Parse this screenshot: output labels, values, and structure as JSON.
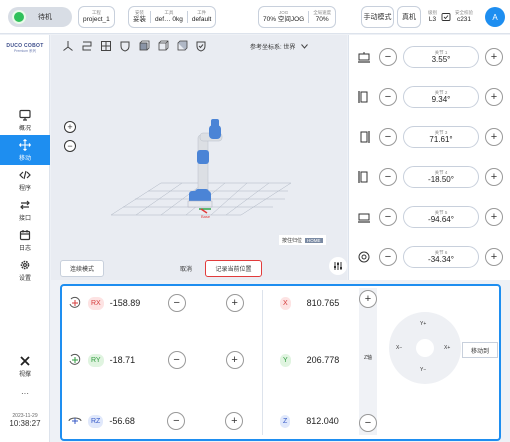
{
  "topbar": {
    "status": "待机",
    "project": {
      "label": "工程",
      "value": "project_1"
    },
    "install": {
      "label": "安装",
      "value": "妥装"
    },
    "tool": {
      "label": "工具",
      "value": "def… 0kg"
    },
    "workpiece": {
      "label": "工件",
      "value": "default"
    },
    "jog": {
      "label": "JOG",
      "value": "70% 空间JOG"
    },
    "global_speed": {
      "label": "全局速度",
      "value": "70%"
    },
    "manual_mode": "手动模式",
    "real_machine": "真机",
    "safety_level": {
      "label": "级别",
      "value": "L3"
    },
    "safety_checksum": {
      "label": "安全校验",
      "value": "c231"
    },
    "user_initial": "A"
  },
  "sidebar": {
    "logo_line1": "DUCO COBOT",
    "logo_line2": "Premium 系列",
    "items": [
      {
        "label": "概况",
        "icon": "monitor-icon"
      },
      {
        "label": "移动",
        "icon": "move-arrows-icon"
      },
      {
        "label": "程序",
        "icon": "code-icon"
      },
      {
        "label": "接口",
        "icon": "swap-arrows-icon"
      },
      {
        "label": "日志",
        "icon": "calendar-icon"
      },
      {
        "label": "设置",
        "icon": "gear-icon"
      }
    ],
    "stop_label": "视撑",
    "more_label": "···",
    "date": "2023-11-29",
    "time": "10:38:27"
  },
  "viewport": {
    "coord_system": "参考坐标系: 世界",
    "home_label": "按住归位",
    "home_tag": "HOME",
    "continuous_mode": "连续模式",
    "cancel": "取消",
    "record_position": "记录当前位置",
    "robot_base_label": "Base"
  },
  "joints": [
    {
      "label": "关节 1",
      "value": "3.55°"
    },
    {
      "label": "关节 2",
      "value": "9.34°"
    },
    {
      "label": "关节 3",
      "value": "71.61°"
    },
    {
      "label": "关节 4",
      "value": "-18.50°"
    },
    {
      "label": "关节 5",
      "value": "-94.64°"
    },
    {
      "label": "关节 6",
      "value": "-34.34°"
    }
  ],
  "jog": {
    "rotations": [
      {
        "axis": "RX",
        "value": "-158.89"
      },
      {
        "axis": "RY",
        "value": "-18.71"
      },
      {
        "axis": "RZ",
        "value": "-56.68"
      }
    ],
    "translations": [
      {
        "axis": "X",
        "value": "810.765"
      },
      {
        "axis": "Y",
        "value": "206.778"
      },
      {
        "axis": "Z",
        "value": "812.040"
      }
    ],
    "z_axis_label": "Z轴",
    "dpad": {
      "up": "Y+",
      "down": "Y−",
      "left": "X−",
      "right": "X+"
    },
    "move_to": "移动到"
  },
  "colors": {
    "accent": "#1e8ef0",
    "status_green": "#2fc05a",
    "record_border": "#e23b3b"
  }
}
